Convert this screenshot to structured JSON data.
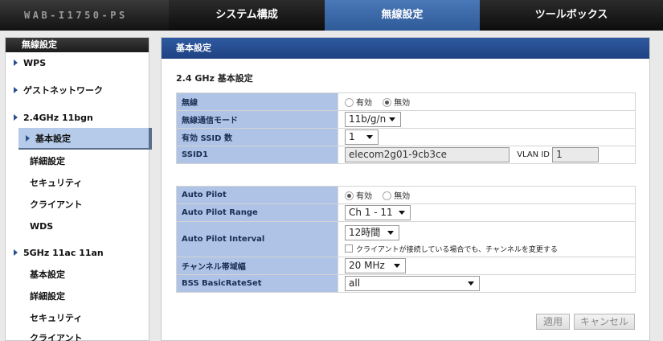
{
  "header": {
    "brand": "WAB-I1750-PS",
    "tabs": [
      {
        "label": "システム構成"
      },
      {
        "label": "無線設定"
      },
      {
        "label": "ツールボックス"
      }
    ]
  },
  "sidebar": {
    "title": "無線設定",
    "items": [
      {
        "label": "WPS"
      },
      {
        "label": "ゲストネットワーク"
      },
      {
        "label": "2.4GHz 11bgn"
      },
      {
        "label": "基本設定"
      },
      {
        "label": "詳細設定"
      },
      {
        "label": "セキュリティ"
      },
      {
        "label": "クライアント"
      },
      {
        "label": "WDS"
      },
      {
        "label": "5GHz 11ac 11an"
      },
      {
        "label": "基本設定"
      },
      {
        "label": "詳細設定"
      },
      {
        "label": "セキュリティ"
      },
      {
        "label": "クライアント"
      }
    ]
  },
  "main": {
    "header": "基本設定",
    "section_title": "2.4 GHz 基本設定",
    "wireless": {
      "label": "無線",
      "opt_on": "有効",
      "opt_off": "無効",
      "selected": "無効"
    },
    "mode": {
      "label": "無線通信モード",
      "value": "11b/g/n"
    },
    "ssid_count": {
      "label": "有効 SSID 数",
      "value": "1"
    },
    "ssid1": {
      "label": "SSID1",
      "value": "elecom2g01-9cb3ce",
      "vlan_label": "VLAN ID",
      "vlan_value": "1"
    },
    "auto_pilot": {
      "label": "Auto Pilot",
      "opt_on": "有効",
      "opt_off": "無効",
      "selected": "有効"
    },
    "auto_pilot_range": {
      "label": "Auto Pilot Range",
      "value": "Ch 1 - 11"
    },
    "auto_pilot_interval": {
      "label": "Auto Pilot Interval",
      "value": "12時間",
      "checkbox_label": "クライアントが接続している場合でも、チャンネルを変更する"
    },
    "channel_width": {
      "label": "チャンネル帯域幅",
      "value": "20 MHz"
    },
    "bss_rate": {
      "label": "BSS BasicRateSet",
      "value": "all"
    },
    "buttons": {
      "apply": "適用",
      "cancel": "キャンセル"
    }
  }
}
